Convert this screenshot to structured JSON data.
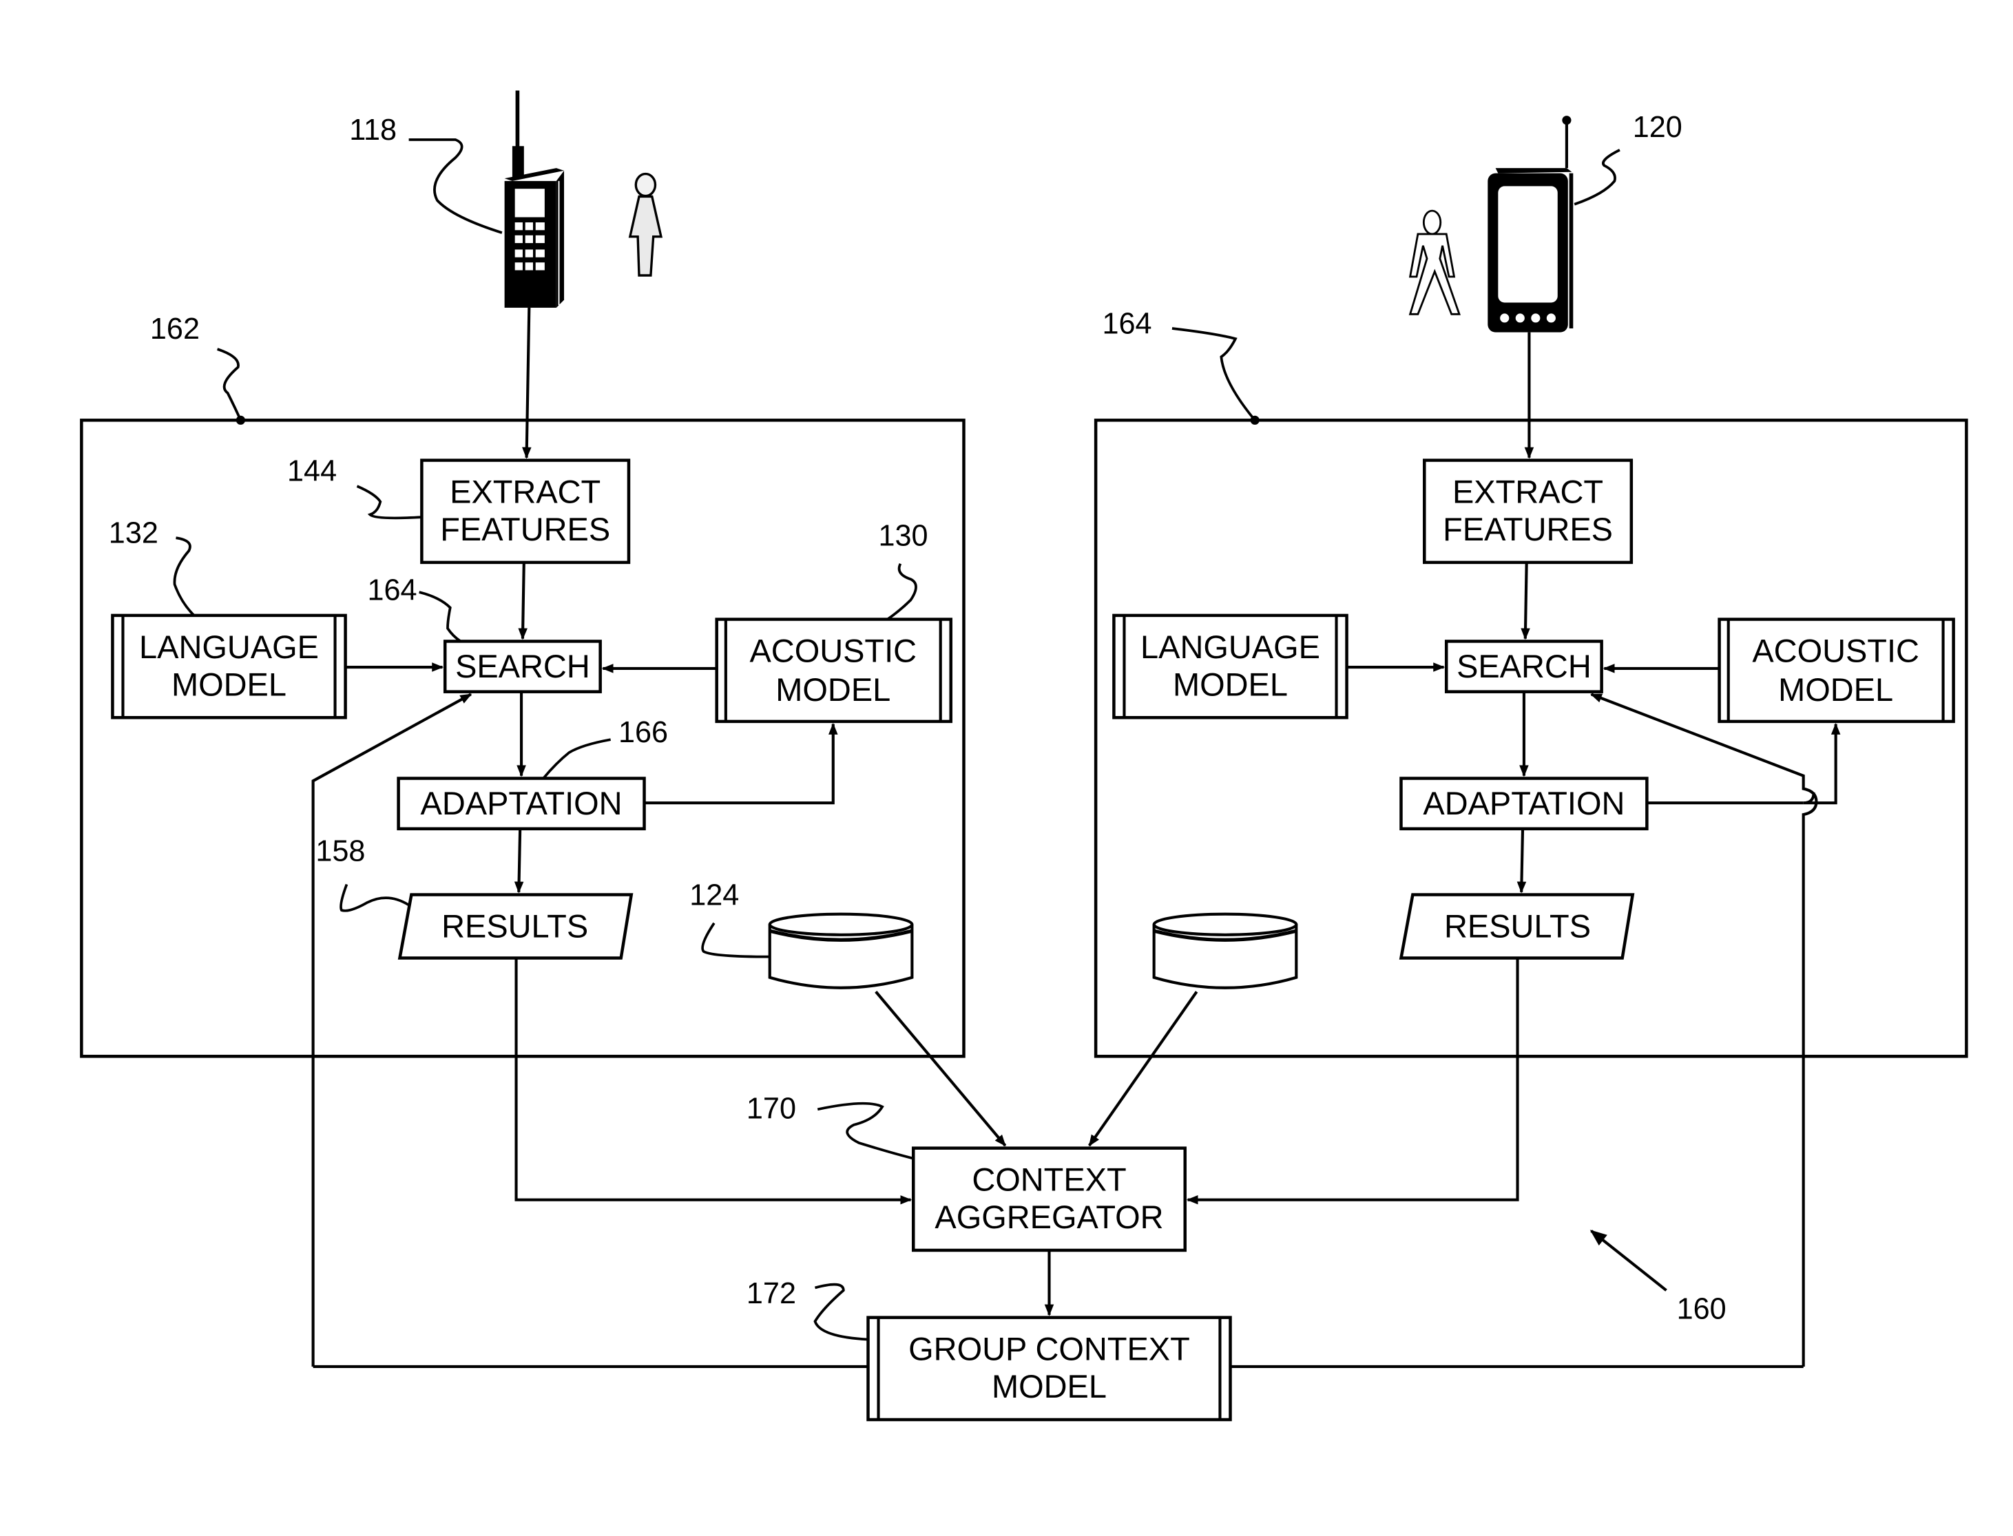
{
  "figure": {
    "ref_system": "160",
    "devices": [
      {
        "ref": "118",
        "type": "feature-phone",
        "user": "user-female"
      },
      {
        "ref": "120",
        "type": "smartphone",
        "user": "user-male"
      }
    ],
    "nodes": {
      "left": {
        "ref_frame": "162",
        "extract": {
          "line1": "EXTRACT",
          "line2": "FEATURES",
          "ref": "144"
        },
        "language": {
          "line1": "LANGUAGE",
          "line2": "MODEL",
          "ref": "132"
        },
        "search": {
          "label": "SEARCH",
          "ref": "164"
        },
        "acoustic": {
          "line1": "ACOUSTIC",
          "line2": "MODEL",
          "ref": "130"
        },
        "adaptation": {
          "label": "ADAPTATION",
          "ref": "166"
        },
        "results": {
          "label": "RESULTS",
          "ref": "158"
        },
        "database": {
          "ref": "124"
        }
      },
      "right": {
        "ref_frame": "164",
        "extract": {
          "line1": "EXTRACT",
          "line2": "FEATURES"
        },
        "language": {
          "line1": "LANGUAGE",
          "line2": "MODEL"
        },
        "search": {
          "label": "SEARCH"
        },
        "acoustic": {
          "line1": "ACOUSTIC",
          "line2": "MODEL"
        },
        "adaptation": {
          "label": "ADAPTATION"
        },
        "results": {
          "label": "RESULTS"
        }
      },
      "aggregator": {
        "line1": "CONTEXT",
        "line2": "AGGREGATOR",
        "ref": "170"
      },
      "group_model": {
        "line1": "GROUP CONTEXT",
        "line2": "MODEL",
        "ref": "172"
      }
    }
  }
}
